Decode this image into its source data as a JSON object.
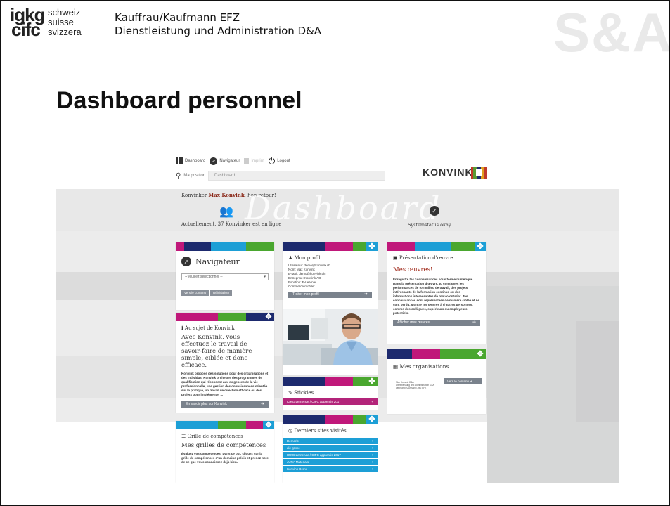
{
  "header": {
    "logo_big_1": "igkg",
    "logo_big_2": "cifc",
    "logo_lang_1": "schweiz",
    "logo_lang_2": "suisse",
    "logo_lang_3": "svizzera",
    "course_line_1": "Kauffrau/Kaufmann EFZ",
    "course_line_2": "Dienstleistung und Administration D&A",
    "watermark": "S&A"
  },
  "slide": {
    "title": "Dashboard personnel"
  },
  "app": {
    "nav": {
      "dashboard": "Dashboard",
      "navigator": "Navigateur",
      "disabled": "Imprim",
      "logout": "Logout"
    },
    "position_label": "Ma position",
    "position_value": "Dashboard",
    "brand": "KONVINK",
    "welcome_prefix": "Konvinker ",
    "welcome_name": "Max Konvink",
    "welcome_suffix": ", bon retour!",
    "dashboard_word": "Dashboard",
    "online_text": "Actuellement, 37 Konvinker est en ligne",
    "system_status": "Systemstatus okay"
  },
  "cards": {
    "navigator": {
      "title": "Navigateur",
      "select": "--Veuillez sélectionner --",
      "btn_1": "Vers le contenu",
      "btn_2": "Réinitialiser"
    },
    "about": {
      "title": "Au sujet de Konvink",
      "headline": "Avec Konvink, vous effectuez le travail de savoir-faire de manière simple, ciblée et donc efficace.",
      "body": "Konvink propose des solutions pour des organisations et des individus. Konvink orchestre des programmes de qualification qui répondent aux exigences de la vie professionnelle, une gestion des connaissances orientée sur la pratique, un travail de direction efficace ou des projets pour implémenter ...",
      "button": "En savoir plus sur Konvink"
    },
    "skills": {
      "title": "Grille de compétences",
      "headline": "Mes grilles de compétences",
      "body": "Évaluez vos compétences! Dans ce but, cliquez sur la grille de compétences d'un domaine précis et prenez note de ce que vous connaissez déjà bien."
    },
    "profile": {
      "title": "Mon profil",
      "l1": "Utilisateur: demo@konvink.ch",
      "l2": "Nom: Max Konvink",
      "l3": "E-Mail: demo@konvink.ch",
      "l4": "Entreprise: Konvink AG",
      "l5": "Fonction: E-Learner",
      "l6": "Commerce mobile:",
      "button": "Traiter mon profil"
    },
    "stickies": {
      "title": "Stickies",
      "item": "IGKG Lernende / CIFC apprentis 2017"
    },
    "visited": {
      "title": "Derniers sites visités",
      "items": [
        "Demeric",
        "die grüne",
        "IGKG Lernende / CIFC apprentis 2017",
        "JURA Materials",
        "Konvink Demo"
      ]
    },
    "work": {
      "title": "Présentation d'œuvre",
      "headline": "Mes œuvres!",
      "body": "Enregistre tes connaissances sous forme numérique. Dans la présentation d'œuvre, tu consignes les performances de ton milieu de travail, des projets intéressants de la formation continue ou des informations intéressantes de ton volontariat. Tes connaissances sont représentées de manière ciblée et ne sont perdu. Montre tes œuvres à d'autres personnes, comme des collègues, supérieurs ou employeurs potentiels.",
      "button": "Afficher mes œuvres"
    },
    "orgs": {
      "title": "Mes organisations",
      "l1": "Max Konvink D&A",
      "l2": "Dienstleistung und Administration D&A",
      "l3": "Lehrgang Kaufmann/-frau EFZ",
      "button": "Vers le contenu"
    }
  },
  "colors": {
    "accent_red": "#a0291a",
    "stripe_navy": "#1d2a6e",
    "stripe_magenta": "#c0187a",
    "stripe_green": "#4aa72f",
    "stripe_cyan": "#1d9fd6",
    "button_grey": "#7a828c"
  }
}
